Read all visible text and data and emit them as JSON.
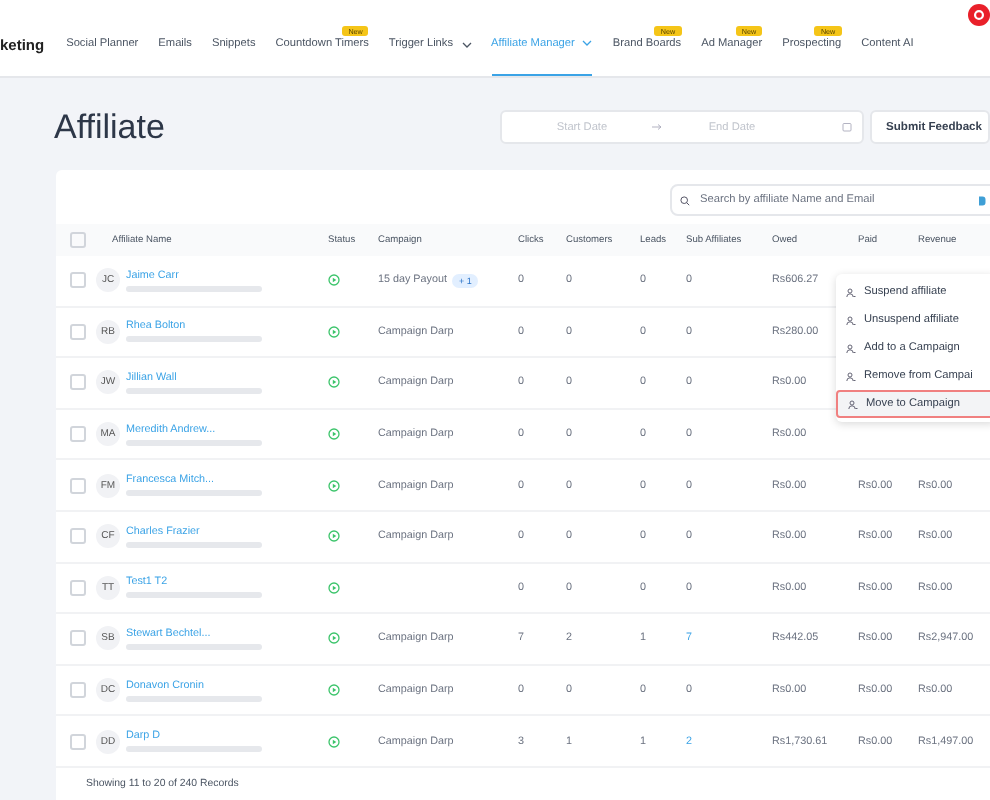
{
  "nav": {
    "brand": "keting",
    "tabs": [
      {
        "label": "Social Planner",
        "selected": false,
        "dropdown": false
      },
      {
        "label": "Emails",
        "selected": false,
        "dropdown": false
      },
      {
        "label": "Snippets",
        "selected": false,
        "dropdown": false
      },
      {
        "label": "Countdown Timers",
        "selected": false,
        "dropdown": false,
        "badge": "New"
      },
      {
        "label": "Trigger Links",
        "selected": false,
        "dropdown": true
      },
      {
        "label": "Affiliate Manager",
        "selected": true,
        "dropdown": true
      },
      {
        "label": "Brand Boards",
        "selected": false,
        "dropdown": false,
        "badge": "New"
      },
      {
        "label": "Ad Manager",
        "selected": false,
        "dropdown": false,
        "badge": "New"
      },
      {
        "label": "Prospecting",
        "selected": false,
        "dropdown": false,
        "badge": "New"
      },
      {
        "label": "Content AI",
        "selected": false,
        "dropdown": false
      }
    ]
  },
  "page": {
    "title": "Affiliate",
    "start_date": {
      "placeholder": "Start Date"
    },
    "end_date": {
      "placeholder": "End Date"
    },
    "feedback_button": "Submit Feedback"
  },
  "select_all_checked": false,
  "search": {
    "placeholder": "Search by affiliate Name and Email"
  },
  "table": {
    "columns": [
      "Affiliate Name",
      "Status",
      "Campaign",
      "Clicks",
      "Customers",
      "Leads",
      "Sub Affiliates",
      "Owed",
      "Paid",
      "Revenue"
    ],
    "rows": [
      {
        "checked": false,
        "initials": "JC",
        "name": "Jaime Carr",
        "active": true,
        "campaign": "15 day Payout",
        "campaign_extra": "+ 1",
        "clicks": "0",
        "customers": "0",
        "leads": "0",
        "sub_affiliates": "0",
        "sub_affiliates_link": false,
        "owed": "Rs606.27"
      },
      {
        "checked": false,
        "initials": "RB",
        "name": "Rhea Bolton",
        "active": true,
        "campaign": "Campaign Darp",
        "clicks": "0",
        "customers": "0",
        "leads": "0",
        "sub_affiliates": "0",
        "sub_affiliates_link": false,
        "owed": "Rs280.00"
      },
      {
        "checked": false,
        "initials": "JW",
        "name": "Jillian Wall",
        "active": true,
        "campaign": "Campaign Darp",
        "clicks": "0",
        "customers": "0",
        "leads": "0",
        "sub_affiliates": "0",
        "sub_affiliates_link": false,
        "owed": "Rs0.00"
      },
      {
        "checked": false,
        "initials": "MA",
        "name": "Meredith Andrew...",
        "active": true,
        "campaign": "Campaign Darp",
        "clicks": "0",
        "customers": "0",
        "leads": "0",
        "sub_affiliates": "0",
        "sub_affiliates_link": false,
        "owed": "Rs0.00"
      },
      {
        "checked": false,
        "initials": "FM",
        "name": "Francesca Mitch...",
        "active": true,
        "campaign": "Campaign Darp",
        "clicks": "0",
        "customers": "0",
        "leads": "0",
        "sub_affiliates": "0",
        "sub_affiliates_link": false,
        "owed": "Rs0.00",
        "paid": "Rs0.00",
        "revenue": "Rs0.00"
      },
      {
        "checked": false,
        "initials": "CF",
        "name": "Charles Frazier",
        "active": true,
        "campaign": "Campaign Darp",
        "clicks": "0",
        "customers": "0",
        "leads": "0",
        "sub_affiliates": "0",
        "sub_affiliates_link": false,
        "owed": "Rs0.00",
        "paid": "Rs0.00",
        "revenue": "Rs0.00"
      },
      {
        "checked": false,
        "initials": "TT",
        "name": "Test1 T2",
        "active": true,
        "clicks": "0",
        "customers": "0",
        "leads": "0",
        "sub_affiliates": "0",
        "sub_affiliates_link": false,
        "owed": "Rs0.00",
        "paid": "Rs0.00",
        "revenue": "Rs0.00"
      },
      {
        "checked": false,
        "initials": "SB",
        "name": "Stewart Bechtel...",
        "active": true,
        "campaign": "Campaign Darp",
        "clicks": "7",
        "customers": "2",
        "leads": "1",
        "sub_affiliates": "7",
        "sub_affiliates_link": true,
        "owed": "Rs442.05",
        "paid": "Rs0.00",
        "revenue": "Rs2,947.00"
      },
      {
        "checked": false,
        "initials": "DC",
        "name": "Donavon Cronin",
        "active": true,
        "campaign": "Campaign Darp",
        "clicks": "0",
        "customers": "0",
        "leads": "0",
        "sub_affiliates": "0",
        "sub_affiliates_link": false,
        "owed": "Rs0.00",
        "paid": "Rs0.00",
        "revenue": "Rs0.00"
      },
      {
        "checked": false,
        "initials": "DD",
        "name": "Darp D",
        "active": true,
        "campaign": "Campaign Darp",
        "clicks": "3",
        "customers": "1",
        "leads": "1",
        "sub_affiliates": "2",
        "sub_affiliates_link": true,
        "owed": "Rs1,730.61",
        "paid": "Rs0.00",
        "revenue": "Rs1,497.00"
      }
    ],
    "footer": "Showing 11 to 20 of 240 Records"
  },
  "context_menu": {
    "items": [
      {
        "label": "Suspend affiliate",
        "selected": false
      },
      {
        "label": "Unsuspend affiliate",
        "selected": false
      },
      {
        "label": "Add to a Campaign",
        "selected": false
      },
      {
        "label": "Remove from Campai",
        "selected": false
      },
      {
        "label": "Move to Campaign",
        "selected": true
      }
    ]
  }
}
